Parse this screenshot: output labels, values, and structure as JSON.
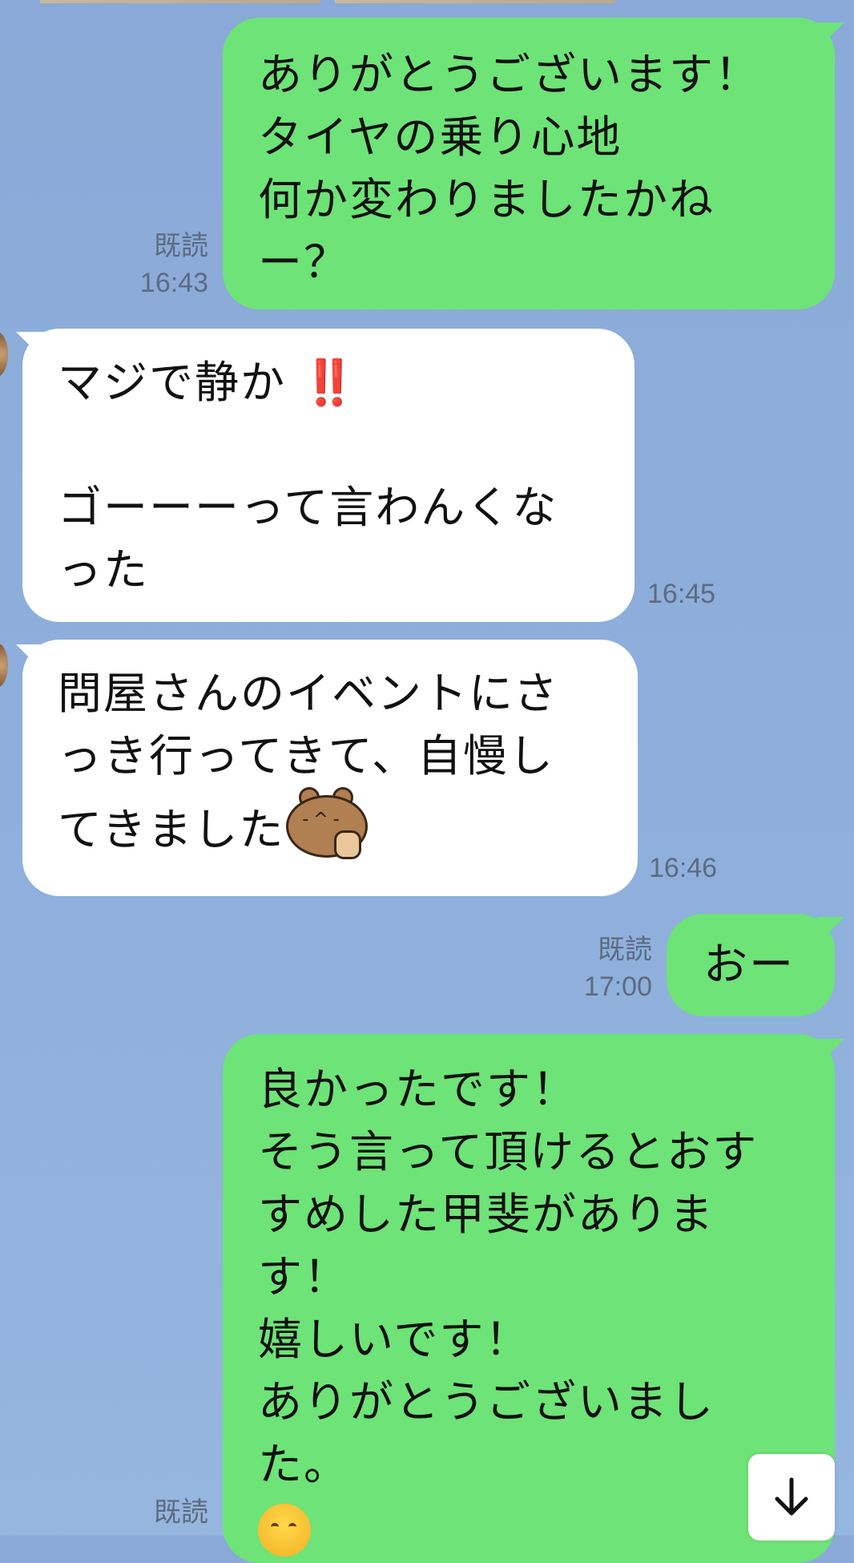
{
  "messages": [
    {
      "id": "m1",
      "side": "out",
      "text": "ありがとうございます！\nタイヤの乗り心地\n何か変わりましたかね\nー？",
      "read": "既読",
      "time": "16:43"
    },
    {
      "id": "m2",
      "side": "in",
      "text_a": "マジで静か",
      "emoji": "‼️",
      "text_b": "\n\nゴーーーって言わんくな\nった",
      "time": "16:45"
    },
    {
      "id": "m3",
      "side": "in",
      "text": "問屋さんのイベントにさ\nっき行ってきて、自慢し\nてきました",
      "sticker": "bear-peace-emoji",
      "time": "16:46"
    },
    {
      "id": "m4",
      "side": "out",
      "text": "おー",
      "read": "既読",
      "time": "17:00"
    },
    {
      "id": "m5",
      "side": "out",
      "text": "良かったです！\nそう言って頂けるとおす\nすめした甲斐がありま\nす！\n嬉しいです！\nありがとうございまし\nた。",
      "emoji": "smiling-face-emoji",
      "read": "既読"
    }
  ],
  "icons": {
    "scroll_down": "arrow-down-icon"
  },
  "colors": {
    "outgoing": "#6ee377",
    "incoming": "#ffffff",
    "background": "#8aa9d8"
  }
}
